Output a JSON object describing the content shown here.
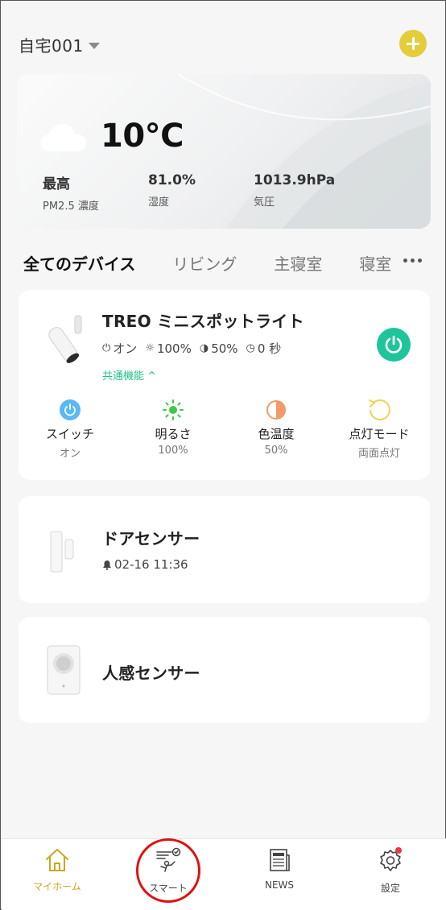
{
  "header": {
    "home_name": "自宅001"
  },
  "weather": {
    "temperature": "10°C",
    "stats": [
      {
        "value": "最高",
        "label": "PM2.5 濃度"
      },
      {
        "value": "81.0%",
        "label": "湿度"
      },
      {
        "value": "1013.9hPa",
        "label": "気圧"
      }
    ]
  },
  "tabs": [
    "全てのデバイス",
    "リビング",
    "主寝室",
    "寝室"
  ],
  "devices": [
    {
      "name": "TREO ミニスポットライト",
      "status": {
        "power": "オン",
        "brightness": "100%",
        "color_temp": "50%",
        "timer": "0 秒"
      },
      "common_label": "共通機能 ^",
      "features": [
        {
          "label": "スイッチ",
          "value": "オン"
        },
        {
          "label": "明るさ",
          "value": "100%"
        },
        {
          "label": "色温度",
          "value": "50%"
        },
        {
          "label": "点灯モード",
          "value": "両面点灯"
        }
      ]
    },
    {
      "name": "ドアセンサー",
      "event": "02-16 11:36"
    },
    {
      "name": "人感センサー"
    }
  ],
  "nav": [
    {
      "label": "マイホーム",
      "icon": "home-icon"
    },
    {
      "label": "スマート",
      "icon": "smart-scene-icon"
    },
    {
      "label": "NEWS",
      "icon": "news-icon"
    },
    {
      "label": "設定",
      "icon": "settings-icon"
    }
  ],
  "colors": {
    "accent": "#e4cc3a",
    "power_on": "#1fc49a",
    "nav_active": "#c9a91f",
    "annotation": "#e01010"
  }
}
